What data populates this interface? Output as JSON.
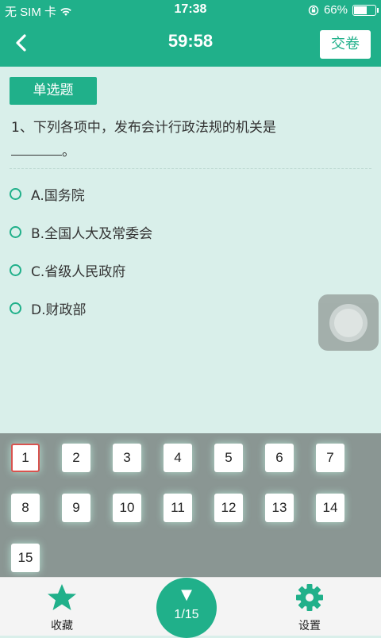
{
  "status_bar": {
    "carrier": "无 SIM 卡",
    "time": "17:38",
    "battery_percent": "66%",
    "battery_level": 0.66
  },
  "nav": {
    "timer": "59:58",
    "submit_label": "交卷"
  },
  "question": {
    "type_label": "单选题",
    "text": "1、下列各项中，发布会计行政法规的机关是",
    "suffix": "。",
    "options": [
      {
        "label": "A.国务院"
      },
      {
        "label": "B.全国人大及常委会"
      },
      {
        "label": "C.省级人民政府"
      },
      {
        "label": "D.财政部"
      }
    ]
  },
  "answer_sheet": {
    "numbers": [
      "1",
      "2",
      "3",
      "4",
      "5",
      "6",
      "7",
      "8",
      "9",
      "10",
      "11",
      "12",
      "13",
      "14",
      "15"
    ],
    "current": "1"
  },
  "tab_bar": {
    "favorite_label": "收藏",
    "settings_label": "设置",
    "progress": "1/15"
  },
  "colors": {
    "primary": "#20b08a",
    "background": "#d9efea",
    "panel": "#8a9693",
    "current_border": "#d9534f"
  }
}
